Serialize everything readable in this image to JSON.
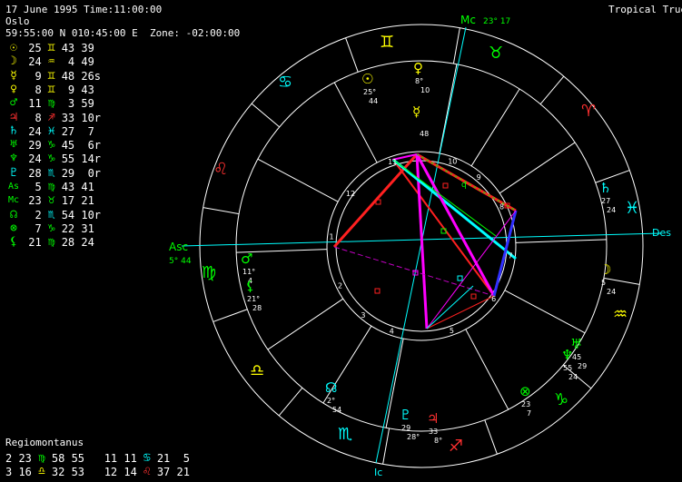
{
  "header": {
    "line1": "17 June 1995 Time:11:00:00",
    "line2": "Oslo",
    "line3": "59:55:00 N 010:45:00 E  Zone: -02:00:00",
    "mode": "Tropical True"
  },
  "positions": [
    {
      "glyph": "☉",
      "glyph_name": "sun-icon",
      "color": "#ffff00",
      "deg": "25",
      "sign": "♊",
      "sign_name": "gemini-icon",
      "sign_color": "#ffff00",
      "min": "43 39"
    },
    {
      "glyph": "☽",
      "glyph_name": "moon-icon",
      "color": "#ffff00",
      "deg": "24",
      "sign": "♒",
      "sign_name": "aquarius-icon",
      "sign_color": "#ffff00",
      "min": " 4 49"
    },
    {
      "glyph": "☿",
      "glyph_name": "mercury-icon",
      "color": "#ffff00",
      "deg": " 9",
      "sign": "♊",
      "sign_name": "gemini-icon",
      "sign_color": "#ffff00",
      "min": "48 26s"
    },
    {
      "glyph": "♀",
      "glyph_name": "venus-icon",
      "color": "#ffff00",
      "deg": " 8",
      "sign": "♊",
      "sign_name": "gemini-icon",
      "sign_color": "#ffff00",
      "min": " 9 43"
    },
    {
      "glyph": "♂",
      "glyph_name": "mars-icon",
      "color": "#00ff00",
      "deg": "11",
      "sign": "♍",
      "sign_name": "virgo-icon",
      "sign_color": "#00ff00",
      "min": " 3 59"
    },
    {
      "glyph": "♃",
      "glyph_name": "jupiter-icon",
      "color": "#ff3030",
      "deg": " 8",
      "sign": "♐",
      "sign_name": "sagittarius-icon",
      "sign_color": "#ff3030",
      "min": "33 10r"
    },
    {
      "glyph": "♄",
      "glyph_name": "saturn-icon",
      "color": "#00ffff",
      "deg": "24",
      "sign": "♓",
      "sign_name": "pisces-icon",
      "sign_color": "#00ffff",
      "min": "27  7"
    },
    {
      "glyph": "♅",
      "glyph_name": "uranus-icon",
      "color": "#00ff00",
      "deg": "29",
      "sign": "♑",
      "sign_name": "capricorn-icon",
      "sign_color": "#00ff00",
      "min": "45  6r"
    },
    {
      "glyph": "♆",
      "glyph_name": "neptune-icon",
      "color": "#00ff00",
      "deg": "24",
      "sign": "♑",
      "sign_name": "capricorn-icon",
      "sign_color": "#00ff00",
      "min": "55 14r"
    },
    {
      "glyph": "♇",
      "glyph_name": "pluto-icon",
      "color": "#00ffff",
      "deg": "28",
      "sign": "♏",
      "sign_name": "scorpio-icon",
      "sign_color": "#00ffff",
      "min": "29  0r"
    },
    {
      "glyph": "As",
      "glyph_name": "ascendant-label",
      "color": "#00ff00",
      "deg": " 5",
      "sign": "♍",
      "sign_name": "virgo-icon",
      "sign_color": "#00ff00",
      "min": "43 41"
    },
    {
      "glyph": "Mc",
      "glyph_name": "midheaven-label",
      "color": "#00ff00",
      "deg": "23",
      "sign": "♉",
      "sign_name": "taurus-icon",
      "sign_color": "#00ff00",
      "min": "17 21"
    },
    {
      "glyph": "☊",
      "glyph_name": "north-node-icon",
      "color": "#00ff00",
      "deg": " 2",
      "sign": "♏",
      "sign_name": "scorpio-icon",
      "sign_color": "#00ffff",
      "min": "54 10r"
    },
    {
      "glyph": "⊗",
      "glyph_name": "part-of-fortune-icon",
      "color": "#00ff00",
      "deg": " 7",
      "sign": "♑",
      "sign_name": "capricorn-icon",
      "sign_color": "#00ff00",
      "min": "22 31"
    },
    {
      "glyph": "⚸",
      "glyph_name": "lilith-icon",
      "color": "#00ff00",
      "deg": "21",
      "sign": "♍",
      "sign_name": "virgo-icon",
      "sign_color": "#00ff00",
      "min": "28 24"
    }
  ],
  "house_system": "Regiomontanus",
  "house_rows": [
    {
      "n1": "2",
      "d1": "23",
      "s1": "♍",
      "s1_name": "virgo-icon",
      "c1": "#00ff00",
      "m1": "58 55",
      "n2": "11",
      "d2": "11",
      "s2": "♋",
      "s2_name": "cancer-icon",
      "c2": "#00ffff",
      "m2": "21  5"
    },
    {
      "n1": "3",
      "d1": "16",
      "s1": "♎",
      "s1_name": "libra-icon",
      "c1": "#ffff00",
      "m1": "32 53",
      "n2": "12",
      "d2": "14",
      "s2": "♌",
      "s2_name": "leo-icon",
      "c2": "#ff3030",
      "m2": "37 21"
    }
  ],
  "wheel": {
    "asc_label": "Asc",
    "asc_pos": "5° 44",
    "des_label": "Des",
    "mc_label": "Mc",
    "mc_pos": "23° 17",
    "ic_label": "Ic",
    "house_numbers": [
      "1",
      "2",
      "3",
      "4",
      "5",
      "6",
      "7",
      "8",
      "9",
      "10",
      "11",
      "12"
    ],
    "planet_labels": [
      {
        "name": "sun",
        "glyph": "☉",
        "color": "#ffff00",
        "deg": "25°",
        "min": "44"
      },
      {
        "name": "venus",
        "glyph": "♀",
        "color": "#ffff00",
        "deg": "8°",
        "min": "10"
      },
      {
        "name": "mercury",
        "glyph": "☿",
        "color": "#ffff00",
        "deg": "",
        "min": "48"
      },
      {
        "name": "saturn",
        "glyph": "♄",
        "color": "#00ffff",
        "deg": "27",
        "min": "24"
      },
      {
        "name": "moon",
        "glyph": "☽",
        "color": "#ffff00",
        "deg": "5",
        "min": "24"
      },
      {
        "name": "uranus",
        "glyph": "♅",
        "color": "#00ff00",
        "deg": "45",
        "min": "29"
      },
      {
        "name": "neptune",
        "glyph": "♆",
        "color": "#00ff00",
        "deg": "55",
        "min": "24"
      },
      {
        "name": "fortune",
        "glyph": "⊗",
        "color": "#00ff00",
        "deg": "23",
        "min": "7"
      },
      {
        "name": "jupiter",
        "glyph": "♃",
        "color": "#ff3030",
        "deg": "33",
        "min": "8°"
      },
      {
        "name": "pluto",
        "glyph": "♇",
        "color": "#00ffff",
        "deg": "29",
        "min": "28°"
      },
      {
        "name": "node",
        "glyph": "☊",
        "color": "#00ffff",
        "deg": "2°",
        "min": "54"
      },
      {
        "name": "mars",
        "glyph": "♂",
        "color": "#00ff00",
        "deg": "11°",
        "min": "4"
      },
      {
        "name": "lilith",
        "glyph": "⚸",
        "color": "#00ff00",
        "deg": "21°",
        "min": "28"
      }
    ],
    "aspect_marker": "q"
  }
}
